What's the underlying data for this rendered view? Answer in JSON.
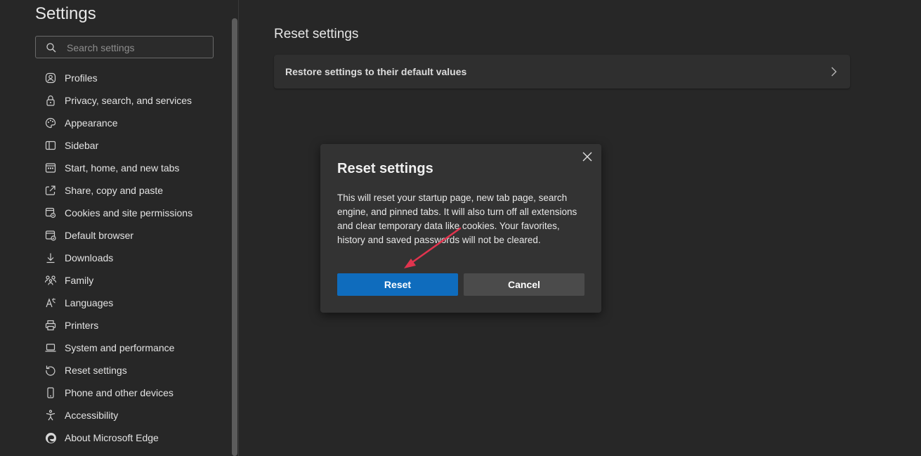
{
  "sidebar": {
    "title": "Settings",
    "search_placeholder": "Search settings",
    "items": [
      {
        "label": "Profiles",
        "icon": "profile-icon"
      },
      {
        "label": "Privacy, search, and services",
        "icon": "lock-icon"
      },
      {
        "label": "Appearance",
        "icon": "appearance-icon"
      },
      {
        "label": "Sidebar",
        "icon": "sidebar-icon"
      },
      {
        "label": "Start, home, and new tabs",
        "icon": "home-icon"
      },
      {
        "label": "Share, copy and paste",
        "icon": "share-icon"
      },
      {
        "label": "Cookies and site permissions",
        "icon": "cookies-icon"
      },
      {
        "label": "Default browser",
        "icon": "browser-icon"
      },
      {
        "label": "Downloads",
        "icon": "download-icon"
      },
      {
        "label": "Family",
        "icon": "family-icon"
      },
      {
        "label": "Languages",
        "icon": "languages-icon"
      },
      {
        "label": "Printers",
        "icon": "printer-icon"
      },
      {
        "label": "System and performance",
        "icon": "laptop-icon"
      },
      {
        "label": "Reset settings",
        "icon": "reset-icon"
      },
      {
        "label": "Phone and other devices",
        "icon": "phone-icon"
      },
      {
        "label": "Accessibility",
        "icon": "accessibility-icon"
      },
      {
        "label": "About Microsoft Edge",
        "icon": "edge-logo-icon"
      }
    ]
  },
  "main": {
    "title": "Reset settings",
    "restore_label": "Restore settings to their default values"
  },
  "dialog": {
    "title": "Reset settings",
    "body": "This will reset your startup page, new tab page, search engine, and pinned tabs. It will also turn off all extensions and clear temporary data like cookies. Your favorites, history and saved passwords will not be cleared.",
    "reset_label": "Reset",
    "cancel_label": "Cancel"
  },
  "colors": {
    "accent": "#0f6cbd",
    "annotation_arrow": "#e0344e"
  }
}
